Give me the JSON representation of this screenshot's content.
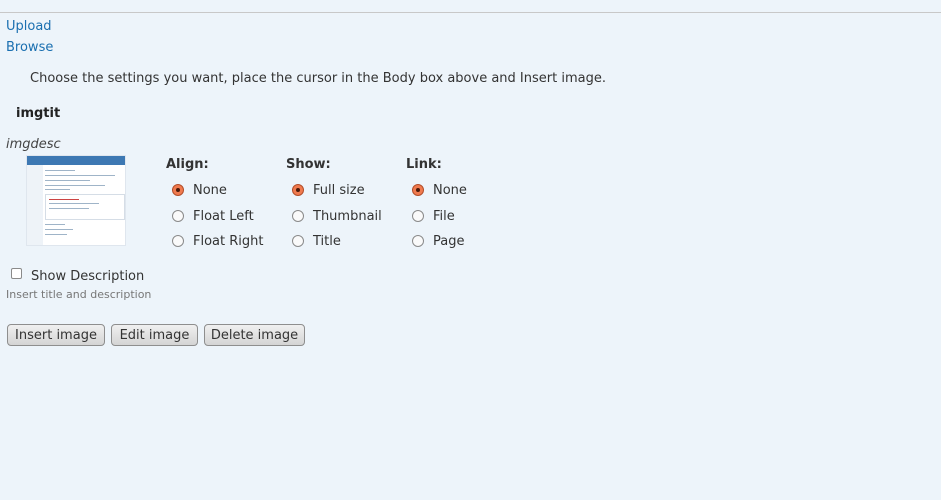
{
  "links": {
    "upload": "Upload",
    "browse": "Browse"
  },
  "instructions": "Choose the settings you want, place the cursor in the Body box above and Insert image.",
  "image": {
    "title": "imgtit",
    "description": "imgdesc"
  },
  "align": {
    "heading": "Align:",
    "options": [
      {
        "label": "None",
        "checked": true
      },
      {
        "label": "Float Left",
        "checked": false
      },
      {
        "label": "Float Right",
        "checked": false
      }
    ]
  },
  "show": {
    "heading": "Show:",
    "options": [
      {
        "label": "Full size",
        "checked": true
      },
      {
        "label": "Thumbnail",
        "checked": false
      },
      {
        "label": "Title",
        "checked": false
      }
    ]
  },
  "link": {
    "heading": "Link:",
    "options": [
      {
        "label": "None",
        "checked": true
      },
      {
        "label": "File",
        "checked": false
      },
      {
        "label": "Page",
        "checked": false
      }
    ]
  },
  "show_description": {
    "label": "Show Description",
    "checked": false,
    "hint": "Insert title and description"
  },
  "buttons": {
    "insert": "Insert image",
    "edit": "Edit image",
    "delete": "Delete image"
  },
  "colors": {
    "link": "#1a6fb0",
    "radio_checked": "#f07a4e",
    "background": "#edf4fa"
  }
}
